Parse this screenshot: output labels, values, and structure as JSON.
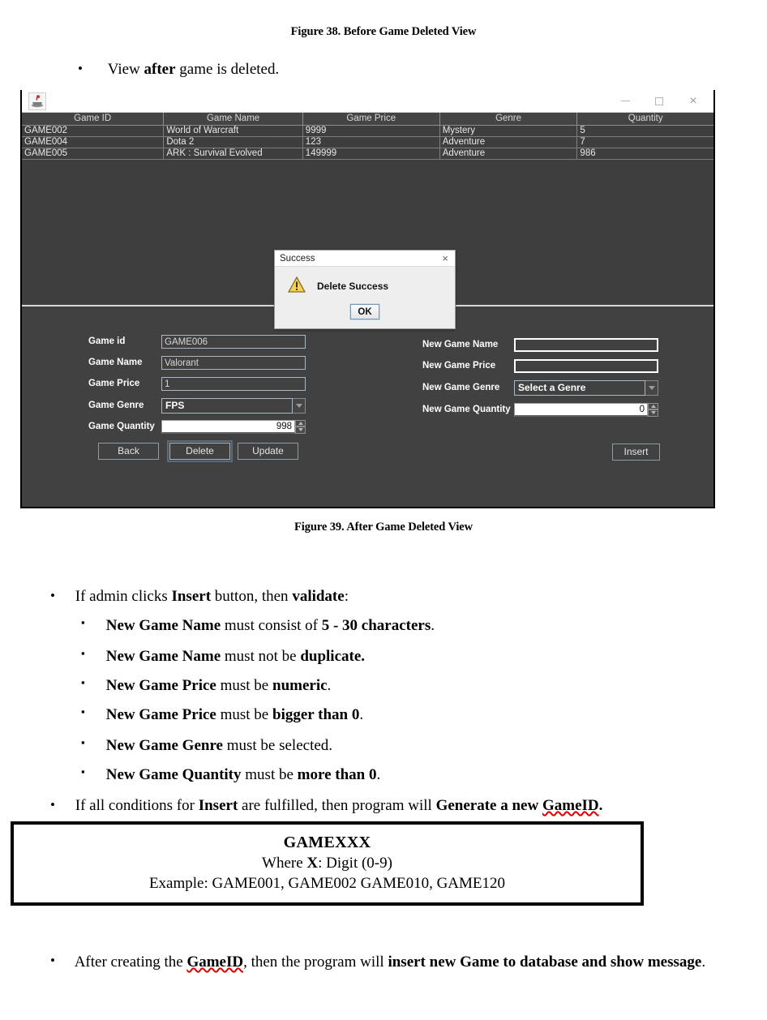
{
  "document": {
    "figure_caption_top": "Figure 38. Before Game Deleted View",
    "bullet_after_delete": {
      "pre": "View ",
      "bold": "after",
      "post": " game is deleted."
    },
    "figure_caption_bottom": "Figure 39. After Game Deleted View",
    "validate_intro": {
      "p1": "If admin clicks ",
      "b1": "Insert",
      "p2": " button, then ",
      "b2": "validate",
      "p3": ":"
    },
    "validate_rules": [
      {
        "b1": "New Game Name",
        "mid": " must consist of ",
        "b2": "5 - 30 characters",
        "tail": "."
      },
      {
        "b1": "New Game Name",
        "mid": " must not be ",
        "b2": "duplicate.",
        "tail": ""
      },
      {
        "b1": "New Game Price",
        "mid": " must be ",
        "b2": "numeric",
        "tail": "."
      },
      {
        "b1": "New Game Price",
        "mid": " must be ",
        "b2": "bigger than 0",
        "tail": "."
      },
      {
        "b1": "New Game Genre",
        "mid": " must be selected.",
        "b2": "",
        "tail": ""
      },
      {
        "b1": "New Game Quantity",
        "mid": " must be ",
        "b2": "more than 0",
        "tail": "."
      }
    ],
    "generate_line": {
      "p1": "If all conditions for ",
      "b1": "Insert",
      "p2": " are fulfilled, then program will ",
      "b2": "Generate a new ",
      "spell": "GameID",
      "p3": "."
    },
    "gameid_box": {
      "line1": "GAMEXXX",
      "line2_pre": "Where ",
      "line2_bold": "X",
      "line2_post": ": Digit (0-9)",
      "line3": "Example: GAME001, GAME002 GAME010, GAME120"
    },
    "after_create_line": {
      "p1": "After creating the ",
      "spell": "GameID",
      "p2": ", then the program will ",
      "b1": "insert new Game to database and show",
      "p3": " ",
      "b2": "message",
      "p4": "."
    }
  },
  "app": {
    "window": {
      "icon": "java-app-icon",
      "minimize_label": "minimize-icon",
      "maximize_label": "maximize-icon",
      "close_label": "×"
    },
    "colors": {
      "panel_bg": "#414141",
      "table_header_bg": "#444444",
      "table_row_bg": "#3e3e3e",
      "field_border": "#a9b7c6",
      "label_text": "#ffffff",
      "separator": "#d8d8d8"
    },
    "table": {
      "columns": [
        "Game ID",
        "Game Name",
        "Game Price",
        "Genre",
        "Quantity"
      ],
      "rows": [
        {
          "id": "GAME002",
          "name": "World of Warcraft",
          "price": "9999",
          "genre": "Mystery",
          "qty": "5"
        },
        {
          "id": "GAME004",
          "name": "Dota 2",
          "price": "123",
          "genre": "Adventure",
          "qty": "7"
        },
        {
          "id": "GAME005",
          "name": "ARK : Survival Evolved",
          "price": "149999",
          "genre": "Adventure",
          "qty": "986"
        }
      ]
    },
    "left_form": {
      "labels": {
        "game_id": "Game id",
        "game_name": "Game Name",
        "game_price": "Game Price",
        "game_genre": "Game Genre",
        "game_quantity": "Game Quantity"
      },
      "values": {
        "game_id": "GAME006",
        "game_name": "Valorant",
        "game_price": "1",
        "game_genre": "FPS",
        "game_quantity": "998"
      },
      "buttons": {
        "back": "Back",
        "delete": "Delete",
        "update": "Update"
      }
    },
    "right_form": {
      "labels": {
        "new_game_name": "New Game Name",
        "new_game_price": "New Game Price",
        "new_game_genre": "New Game Genre",
        "new_game_quantity": "New Game Quantity"
      },
      "values": {
        "new_game_name": "",
        "new_game_price": "",
        "new_game_genre": "Select a Genre",
        "new_game_quantity": "0"
      },
      "buttons": {
        "insert": "Insert"
      }
    },
    "dialog": {
      "title": "Success",
      "close": "×",
      "icon": "warning-triangle-icon",
      "message": "Delete Success",
      "ok_label": "OK"
    }
  }
}
